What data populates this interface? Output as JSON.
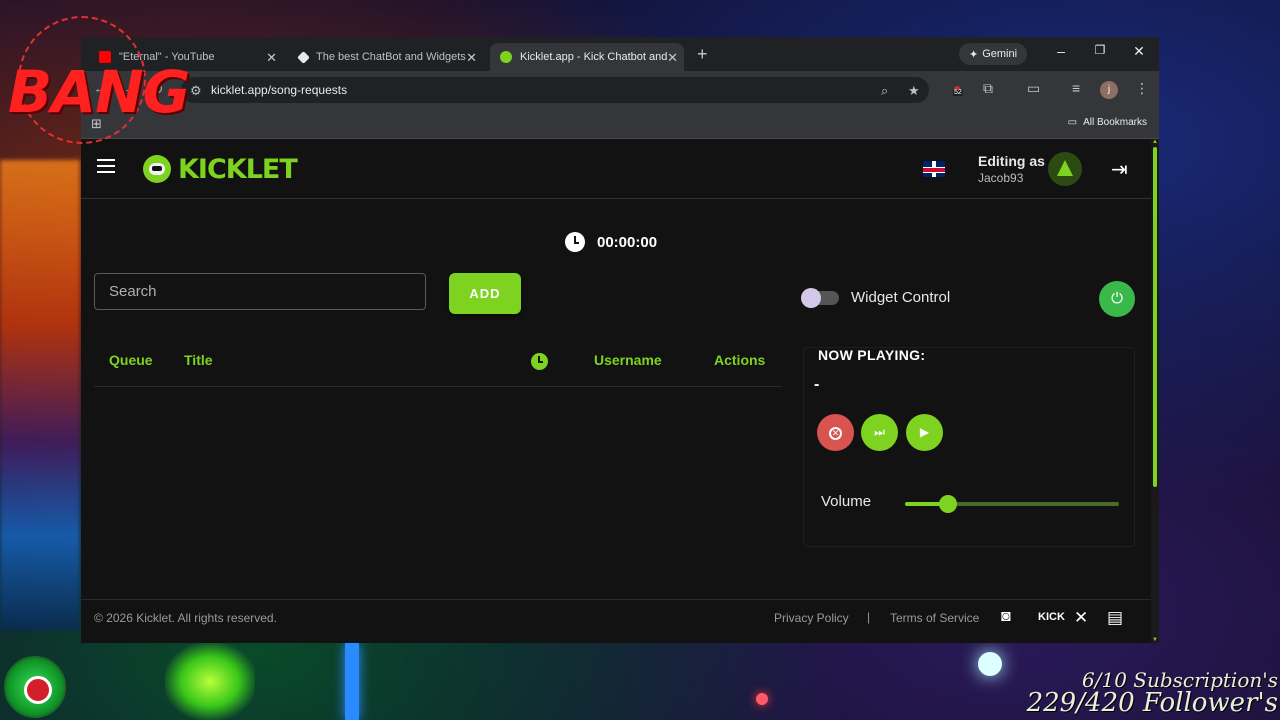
{
  "browser": {
    "tabs": [
      {
        "title": "\"Eternal\" - YouTube",
        "favicon_color": "#ff0000",
        "active": false
      },
      {
        "title": "The best ChatBot and Widgets",
        "favicon_color": "#e8e8e8",
        "active": false
      },
      {
        "title": "Kicklet.app - Kick Chatbot and",
        "favicon_color": "#7ed321",
        "active": true
      }
    ],
    "gemini_label": "Gemini",
    "url": "kicklet.app/song-requests",
    "extension_badge": "52",
    "profile_initial": "j",
    "all_bookmarks": "All Bookmarks"
  },
  "app": {
    "brand": "KICKLET",
    "editing_as_label": "Editing as",
    "username": "Jacob93",
    "timer": "00:00:00",
    "search_placeholder": "Search",
    "add_label": "ADD",
    "queue_columns": {
      "queue": "Queue",
      "title": "Title",
      "username": "Username",
      "actions": "Actions"
    },
    "widget_control_label": "Widget Control",
    "now_playing_label": "NOW PLAYING:",
    "now_playing_song": "-",
    "volume_label": "Volume",
    "volume_level": 0.2,
    "accent_color": "#7ed321"
  },
  "footer": {
    "copyright": "© 2026 Kicklet. All rights reserved.",
    "privacy": "Privacy Policy",
    "separator": "|",
    "terms": "Terms of Service",
    "kick_label": "KICK"
  },
  "overlay": {
    "bang_text": "BANG",
    "subscriptions": "6/10 Subscription's",
    "followers": "229/420 Follower's"
  }
}
